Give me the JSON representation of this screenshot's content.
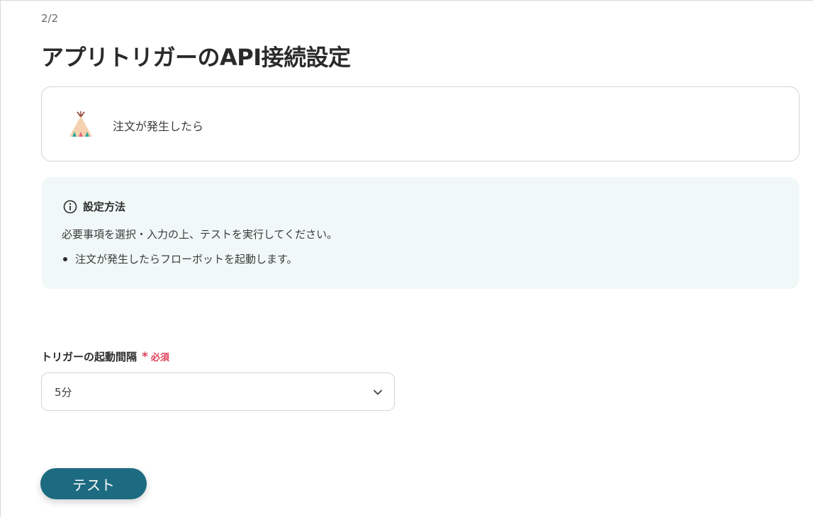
{
  "header": {
    "step": "2/2",
    "title": "アプリトリガーのAPI接続設定"
  },
  "trigger": {
    "icon": "tent-app-icon",
    "label": "注文が発生したら"
  },
  "info": {
    "icon": "info-circle-icon",
    "title": "設定方法",
    "description": "必要事項を選択・入力の上、テストを実行してください。",
    "items": [
      "注文が発生したらフローボットを起動します。"
    ]
  },
  "interval_field": {
    "label": "トリガーの起動間隔",
    "required_mark": "*",
    "required_text": "必須",
    "value": "5分",
    "icon": "chevron-down-icon"
  },
  "actions": {
    "test_label": "テスト"
  },
  "colors": {
    "accent": "#1d6b80",
    "required": "#e0425a",
    "info_bg": "#f1f9f8"
  }
}
